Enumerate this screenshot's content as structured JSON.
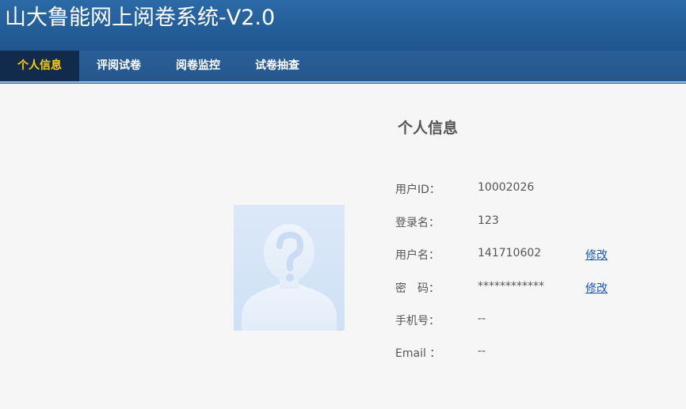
{
  "header": {
    "title": "山大鲁能网上阅卷系统-V2.0"
  },
  "nav": {
    "items": [
      {
        "label": "个人信息",
        "active": true
      },
      {
        "label": "评阅试卷",
        "active": false
      },
      {
        "label": "阅卷监控",
        "active": false
      },
      {
        "label": "试卷抽查",
        "active": false
      }
    ]
  },
  "profile": {
    "title": "个人信息",
    "avatar_icon": "unknown-user-silhouette-icon",
    "fields": [
      {
        "label": "用户ID：",
        "value": "10002026"
      },
      {
        "label": "登录名：",
        "value": "123"
      },
      {
        "label": "用户名：",
        "value": "141710602",
        "action": "修改"
      },
      {
        "label": "密　码：",
        "value": "************",
        "action": "修改"
      },
      {
        "label": "手机号：",
        "value": "--"
      },
      {
        "label": "Email ：",
        "value": "--"
      }
    ]
  },
  "colors": {
    "header_bg": "#2465a1",
    "nav_bg": "#24578d",
    "nav_active_bg": "#122b4d",
    "nav_active_text": "#ffd200",
    "link": "#1a54b8",
    "text": "#555555",
    "page_bg": "#f6f6f6"
  }
}
